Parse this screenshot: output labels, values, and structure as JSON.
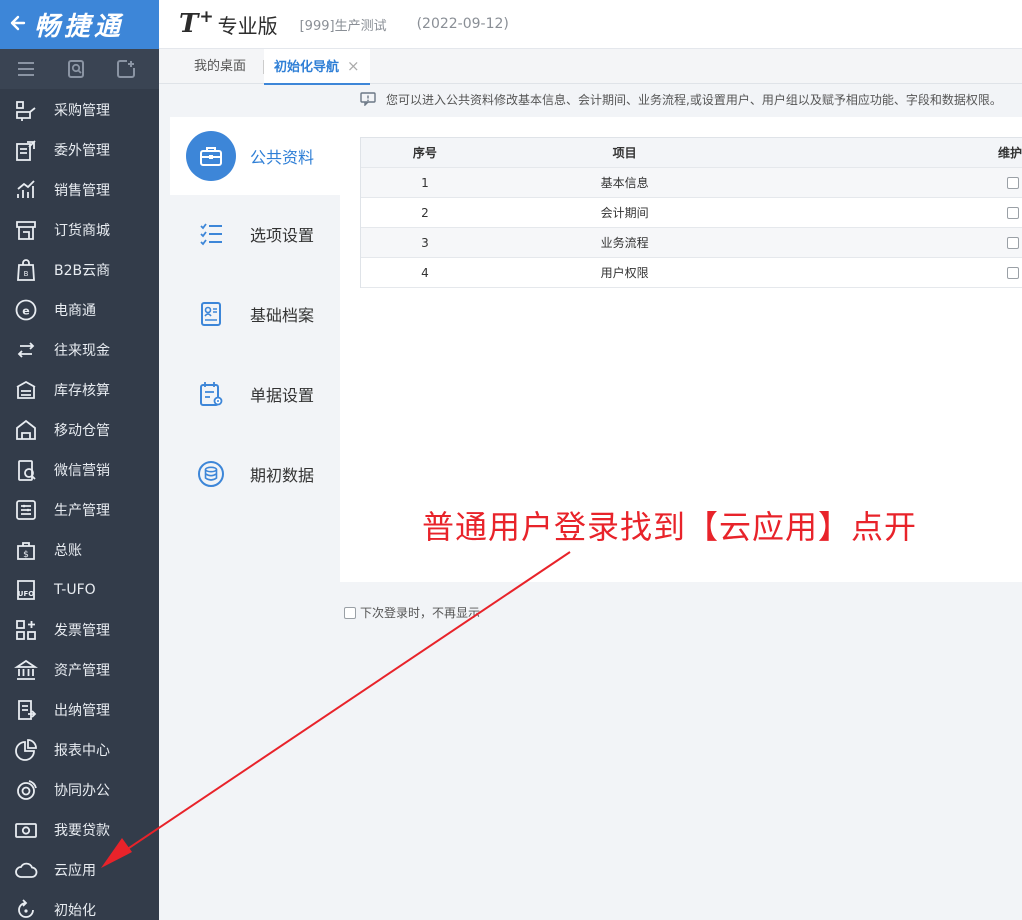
{
  "colors": {
    "accent": "#3d86d8",
    "sidebar_bg": "#333c4a",
    "annotation": "#e8232a"
  },
  "brand": {
    "back_icon": "back-arrow-icon",
    "name": "畅捷通"
  },
  "toolbar": {
    "icons": [
      "menu-icon",
      "search-doc-icon",
      "add-doc-icon"
    ]
  },
  "sidebar": {
    "items": [
      {
        "label": "采购管理",
        "icon": "purchase-icon"
      },
      {
        "label": "委外管理",
        "icon": "outsource-icon"
      },
      {
        "label": "销售管理",
        "icon": "sales-chart-icon"
      },
      {
        "label": "订货商城",
        "icon": "store-icon"
      },
      {
        "label": "B2B云商",
        "icon": "b2b-bag-icon"
      },
      {
        "label": "电商通",
        "icon": "ecommerce-icon"
      },
      {
        "label": "往来现金",
        "icon": "exchange-icon"
      },
      {
        "label": "库存核算",
        "icon": "inventory-icon"
      },
      {
        "label": "移动仓管",
        "icon": "mobile-warehouse-icon"
      },
      {
        "label": "微信营销",
        "icon": "wechat-marketing-icon"
      },
      {
        "label": "生产管理",
        "icon": "production-icon"
      },
      {
        "label": "总账",
        "icon": "ledger-icon"
      },
      {
        "label": "T-UFO",
        "icon": "ufo-icon"
      },
      {
        "label": "发票管理",
        "icon": "invoice-icon"
      },
      {
        "label": "资产管理",
        "icon": "asset-bank-icon"
      },
      {
        "label": "出纳管理",
        "icon": "cashier-icon"
      },
      {
        "label": "报表中心",
        "icon": "report-pie-icon"
      },
      {
        "label": "协同办公",
        "icon": "collaboration-icon"
      },
      {
        "label": "我要贷款",
        "icon": "loan-icon"
      },
      {
        "label": "云应用",
        "icon": "cloud-icon"
      },
      {
        "label": "初始化",
        "icon": "init-icon"
      }
    ]
  },
  "header": {
    "logo_t": "T",
    "logo_plus": "+",
    "edition": "专业版",
    "account": "[999]生产测试",
    "date": "(2022-09-12)"
  },
  "tabs": [
    {
      "label": "我的桌面",
      "active": false
    },
    {
      "label": "初始化导航",
      "active": true,
      "close": "×"
    }
  ],
  "info": {
    "icon": "message-icon",
    "text": "您可以进入公共资料修改基本信息、会计期间、业务流程,或设置用户、用户组以及赋予相应功能、字段和数据权限。"
  },
  "categories": [
    {
      "label": "公共资料",
      "icon": "briefcase-icon",
      "active": true
    },
    {
      "label": "选项设置",
      "icon": "checklist-icon",
      "active": false
    },
    {
      "label": "基础档案",
      "icon": "profile-card-icon",
      "active": false
    },
    {
      "label": "单据设置",
      "icon": "document-settings-icon",
      "active": false
    },
    {
      "label": "期初数据",
      "icon": "database-icon",
      "active": false
    }
  ],
  "table": {
    "headers": [
      "序号",
      "项目",
      "维护"
    ],
    "rows": [
      {
        "no": "1",
        "item": "基本信息"
      },
      {
        "no": "2",
        "item": "会计期间"
      },
      {
        "no": "3",
        "item": "业务流程"
      },
      {
        "no": "4",
        "item": "用户权限"
      }
    ]
  },
  "footer": {
    "dont_show": "下次登录时，不再显示"
  },
  "annotation": {
    "text": "普通用户登录找到【云应用】点开"
  }
}
